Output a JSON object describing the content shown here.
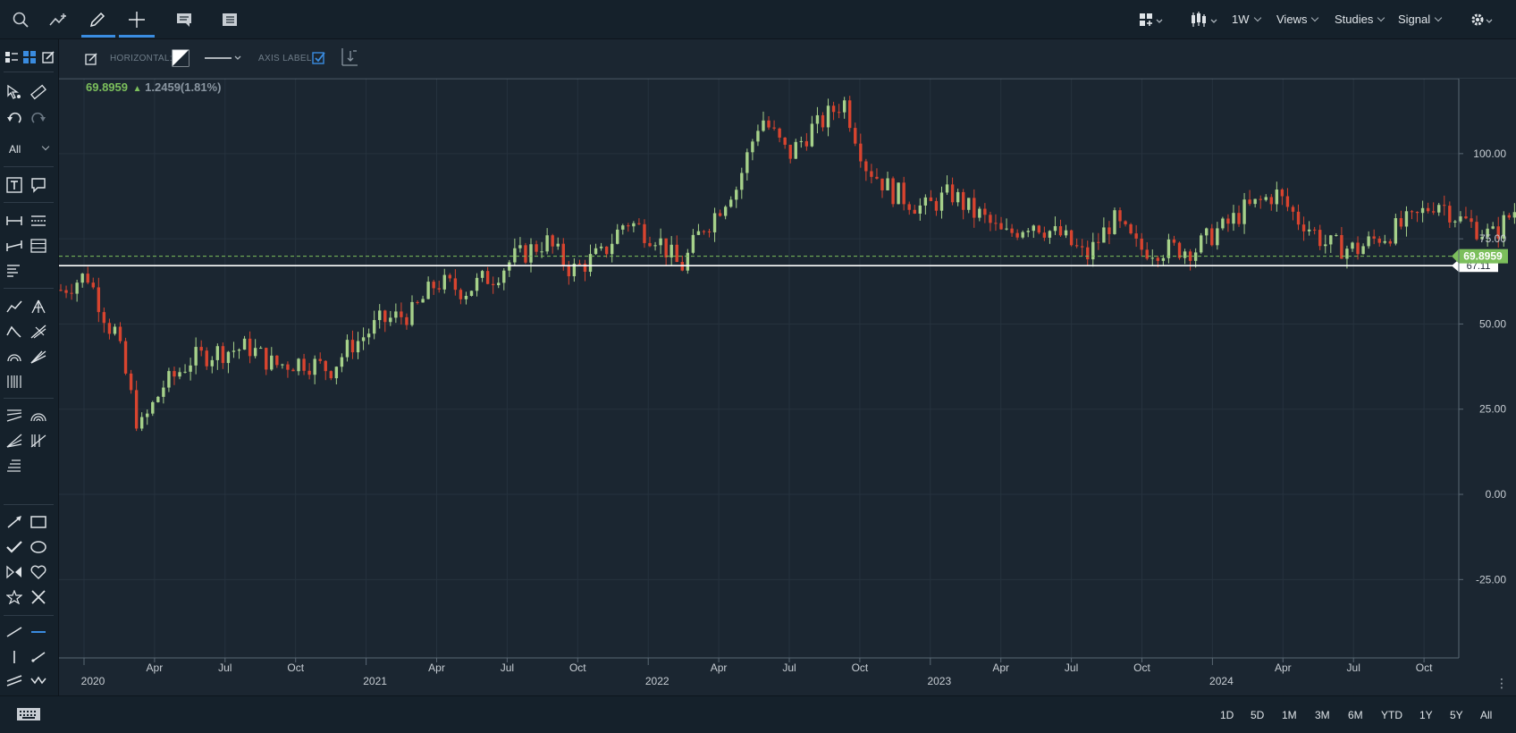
{
  "toolbar": {
    "interval": "1W",
    "views": "Views",
    "studies": "Studies",
    "signal": "Signal"
  },
  "left_toolbar": {
    "filter_all": "All"
  },
  "drawing_settings": {
    "horizontal_label": "HORIZONTAL:",
    "axis_label_label": "AXIS LABEL:"
  },
  "price_header": {
    "last": "69.8959",
    "change": "1.2459(1.81%)",
    "direction": "up"
  },
  "price_tag": {
    "current": "69.8959",
    "line_label": "67.11"
  },
  "x_axis": {
    "ticks": [
      "2020",
      "Apr",
      "Jul",
      "Oct",
      "2021",
      "Apr",
      "Jul",
      "Oct",
      "2022",
      "Apr",
      "Jul",
      "Oct",
      "2023",
      "Apr",
      "Jul",
      "Oct",
      "2024",
      "Apr",
      "Jul",
      "Oct"
    ]
  },
  "y_axis": {
    "ticks": [
      "100.00",
      "75.00",
      "50.00",
      "25.00",
      "0.00",
      "-25.00"
    ]
  },
  "range_buttons": [
    "1D",
    "5D",
    "1M",
    "3M",
    "6M",
    "YTD",
    "1Y",
    "5Y",
    "All"
  ],
  "colors": {
    "up": "#a6d18a",
    "down": "#d8442f",
    "accent": "#3a8ce0",
    "price_tag": "#7cbf5c",
    "background": "#1b2631"
  },
  "chart_data": {
    "type": "candlestick",
    "interval": "1W",
    "ylim": [
      -48,
      122
    ],
    "y_ticks": [
      100,
      75,
      50,
      25,
      0,
      -25
    ],
    "x_ticks": [
      "2020",
      "Apr",
      "Jul",
      "Oct",
      "2021",
      "Apr",
      "Jul",
      "Oct",
      "2022",
      "Apr",
      "Jul",
      "Oct",
      "2023",
      "Apr",
      "Jul",
      "Oct",
      "2024",
      "Apr",
      "Jul",
      "Oct"
    ],
    "horizontal_line": 67.11,
    "last_price": 69.8959,
    "anchors": [
      [
        "2020-01",
        60
      ],
      [
        "2020-02",
        64
      ],
      [
        "2020-03",
        48
      ],
      [
        "2020-04",
        20
      ],
      [
        "2020-05",
        33
      ],
      [
        "2020-06",
        40
      ],
      [
        "2020-07",
        42
      ],
      [
        "2020-08",
        43
      ],
      [
        "2020-09",
        38
      ],
      [
        "2020-10",
        39
      ],
      [
        "2020-11",
        37
      ],
      [
        "2020-12",
        45
      ],
      [
        "2021-01",
        51
      ],
      [
        "2021-02",
        53
      ],
      [
        "2021-03",
        62
      ],
      [
        "2021-04",
        60
      ],
      [
        "2021-05",
        64
      ],
      [
        "2021-06",
        70
      ],
      [
        "2021-07",
        74
      ],
      [
        "2021-08",
        66
      ],
      [
        "2021-09",
        70
      ],
      [
        "2021-10",
        80
      ],
      [
        "2021-11",
        76
      ],
      [
        "2021-12",
        67
      ],
      [
        "2022-01",
        80
      ],
      [
        "2022-02",
        90
      ],
      [
        "2022-03",
        110
      ],
      [
        "2022-04",
        100
      ],
      [
        "2022-05",
        108
      ],
      [
        "2022-06",
        115
      ],
      [
        "2022-07",
        95
      ],
      [
        "2022-08",
        88
      ],
      [
        "2022-09",
        84
      ],
      [
        "2022-10",
        88
      ],
      [
        "2022-11",
        82
      ],
      [
        "2022-12",
        76
      ],
      [
        "2023-01",
        80
      ],
      [
        "2023-02",
        76
      ],
      [
        "2023-03",
        70
      ],
      [
        "2023-04",
        80
      ],
      [
        "2023-05",
        72
      ],
      [
        "2023-06",
        72
      ],
      [
        "2023-07",
        72
      ],
      [
        "2023-08",
        78
      ],
      [
        "2023-09",
        84
      ],
      [
        "2023-10",
        88
      ],
      [
        "2023-11",
        80
      ],
      [
        "2023-12",
        73
      ],
      [
        "2024-01",
        72
      ],
      [
        "2024-02",
        76
      ],
      [
        "2024-03",
        80
      ],
      [
        "2024-04",
        86
      ],
      [
        "2024-05",
        80
      ],
      [
        "2024-06",
        76
      ],
      [
        "2024-07",
        84
      ],
      [
        "2024-08",
        76
      ],
      [
        "2024-09",
        70
      ]
    ]
  }
}
